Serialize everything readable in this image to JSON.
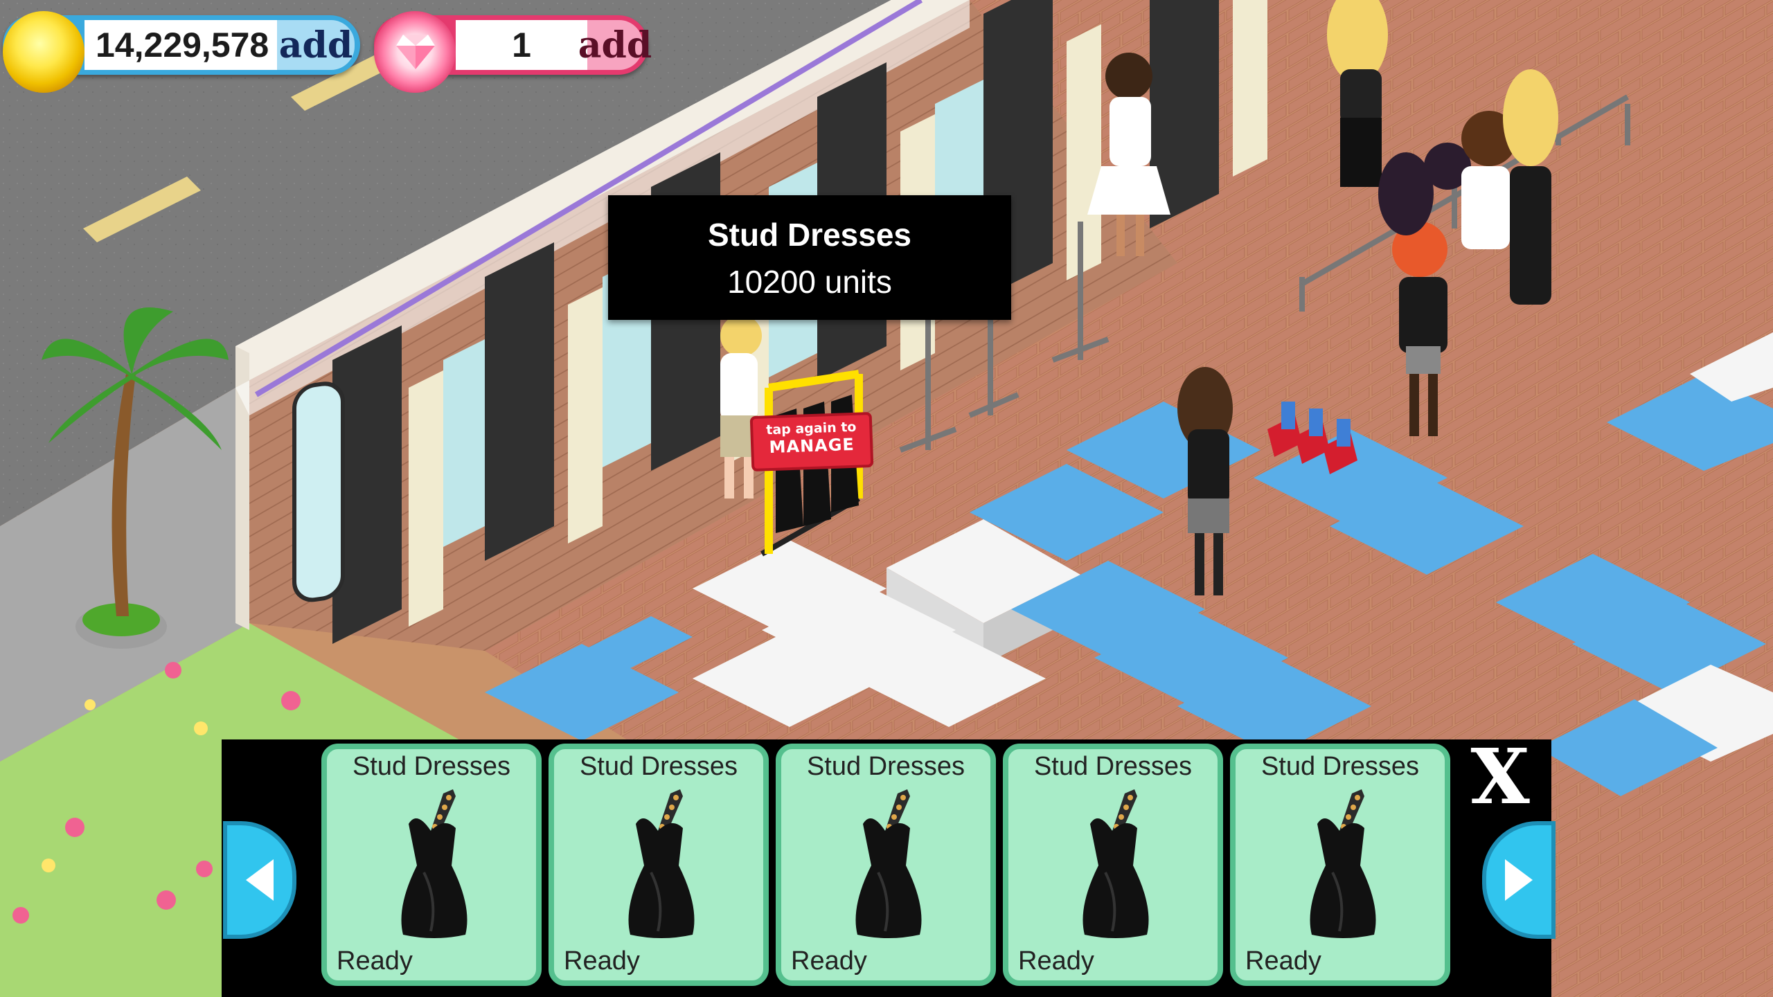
{
  "hud": {
    "coins": {
      "value": "14,229,578",
      "add_label": "add",
      "icon": "gold-coin-icon",
      "color": "#3aa9dd"
    },
    "gems": {
      "value": "1",
      "add_label": "add",
      "icon": "pink-diamond-icon",
      "color": "#e43a6e"
    }
  },
  "tooltip": {
    "title": "Stud Dresses",
    "subtitle": "10200 units"
  },
  "manage_sign": {
    "line1": "tap again to",
    "line2": "MANAGE"
  },
  "item_panel": {
    "close_label": "X",
    "prev_icon": "arrow-left-icon",
    "next_icon": "arrow-right-icon",
    "cards": [
      {
        "title": "Stud Dresses",
        "status": "Ready",
        "icon": "black-stud-dress-icon"
      },
      {
        "title": "Stud Dresses",
        "status": "Ready",
        "icon": "black-stud-dress-icon"
      },
      {
        "title": "Stud Dresses",
        "status": "Ready",
        "icon": "black-stud-dress-icon"
      },
      {
        "title": "Stud Dresses",
        "status": "Ready",
        "icon": "black-stud-dress-icon"
      },
      {
        "title": "Stud Dresses",
        "status": "Ready",
        "icon": "black-stud-dress-icon"
      }
    ]
  },
  "colors": {
    "floor_wood": "#c9936a",
    "brick_floor": "#c88a6a",
    "grass": "#a8d873",
    "asphalt": "#7d7d7d",
    "card_bg": "#a8ecc8",
    "card_border": "#55c08e",
    "arrow_blue": "#31c5ee"
  }
}
